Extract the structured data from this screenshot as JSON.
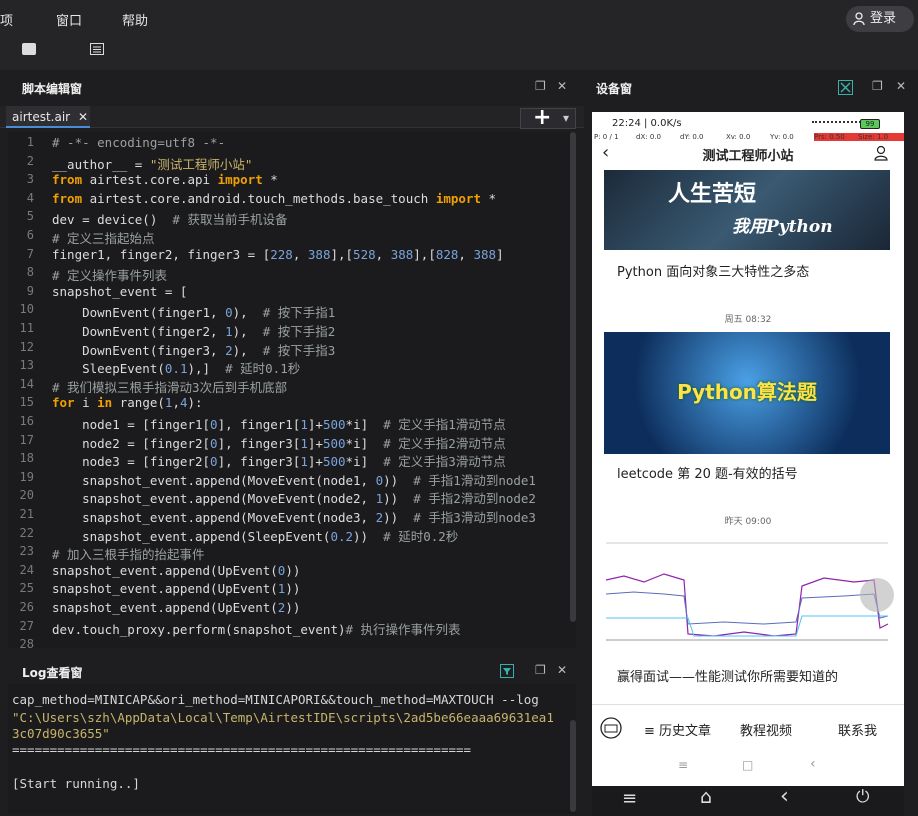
{
  "menu": {
    "items": [
      "项",
      "窗口",
      "帮助"
    ],
    "login": "登录"
  },
  "editor": {
    "title": "脚本编辑窗",
    "tab": "airtest.air",
    "tab_close": "✕",
    "plus": "+",
    "dropdown": "▾",
    "restore": "❐",
    "close": "✕"
  },
  "code_lines": [
    [
      [
        "cm",
        "# -*- encoding=utf8 -*-"
      ]
    ],
    [
      [
        "",
        "__author__ = "
      ],
      [
        "st",
        "\"测试工程师小站\""
      ]
    ],
    [
      [
        "kw",
        "from"
      ],
      [
        "",
        " airtest.core.api "
      ],
      [
        "kw",
        "import"
      ],
      [
        "",
        " *"
      ]
    ],
    [
      [
        "kw",
        "from"
      ],
      [
        "",
        " airtest.core.android.touch_methods.base_touch "
      ],
      [
        "kw",
        "import"
      ],
      [
        "",
        " *"
      ]
    ],
    [
      [
        "",
        "dev = device()  "
      ],
      [
        "cm",
        "# 获取当前手机设备"
      ]
    ],
    [
      [
        "cm",
        "# 定义三指起始点"
      ]
    ],
    [
      [
        "",
        "finger1, finger2, finger3 = ["
      ],
      [
        "nm",
        "228"
      ],
      [
        "",
        ", "
      ],
      [
        "nm",
        "388"
      ],
      [
        "",
        "],["
      ],
      [
        "nm",
        "528"
      ],
      [
        "",
        ", "
      ],
      [
        "nm",
        "388"
      ],
      [
        "",
        "],["
      ],
      [
        "nm",
        "828"
      ],
      [
        "",
        ", "
      ],
      [
        "nm",
        "388"
      ],
      [
        "",
        "]"
      ]
    ],
    [
      [
        "cm",
        "# 定义操作事件列表"
      ]
    ],
    [
      [
        "",
        "snapshot_event = ["
      ]
    ],
    [
      [
        "",
        "    DownEvent(finger1, "
      ],
      [
        "nm",
        "0"
      ],
      [
        "",
        "),  "
      ],
      [
        "cm",
        "# 按下手指1"
      ]
    ],
    [
      [
        "",
        "    DownEvent(finger2, "
      ],
      [
        "nm",
        "1"
      ],
      [
        "",
        "),  "
      ],
      [
        "cm",
        "# 按下手指2"
      ]
    ],
    [
      [
        "",
        "    DownEvent(finger3, "
      ],
      [
        "nm",
        "2"
      ],
      [
        "",
        "),  "
      ],
      [
        "cm",
        "# 按下手指3"
      ]
    ],
    [
      [
        "",
        "    SleepEvent("
      ],
      [
        "nm",
        "0.1"
      ],
      [
        "",
        "),]  "
      ],
      [
        "cm",
        "# 延时0.1秒"
      ]
    ],
    [
      [
        "cm",
        "# 我们模拟三根手指滑动3次后到手机底部"
      ]
    ],
    [
      [
        "kw",
        "for"
      ],
      [
        "",
        " i "
      ],
      [
        "kw",
        "in"
      ],
      [
        "",
        " range("
      ],
      [
        "nm",
        "1"
      ],
      [
        "",
        ","
      ],
      [
        "nm",
        "4"
      ],
      [
        "",
        "):"
      ]
    ],
    [
      [
        "",
        "    node1 = [finger1["
      ],
      [
        "nm",
        "0"
      ],
      [
        "",
        "], finger1["
      ],
      [
        "nm",
        "1"
      ],
      [
        "",
        "]+"
      ],
      [
        "nm",
        "500"
      ],
      [
        "",
        "*i]  "
      ],
      [
        "cm",
        "# 定义手指1滑动节点"
      ]
    ],
    [
      [
        "",
        "    node2 = [finger2["
      ],
      [
        "nm",
        "0"
      ],
      [
        "",
        "], finger3["
      ],
      [
        "nm",
        "1"
      ],
      [
        "",
        "]+"
      ],
      [
        "nm",
        "500"
      ],
      [
        "",
        "*i]  "
      ],
      [
        "cm",
        "# 定义手指2滑动节点"
      ]
    ],
    [
      [
        "",
        "    node3 = [finger2["
      ],
      [
        "nm",
        "0"
      ],
      [
        "",
        "], finger3["
      ],
      [
        "nm",
        "1"
      ],
      [
        "",
        "]+"
      ],
      [
        "nm",
        "500"
      ],
      [
        "",
        "*i]  "
      ],
      [
        "cm",
        "# 定义手指3滑动节点"
      ]
    ],
    [
      [
        "",
        "    snapshot_event.append(MoveEvent(node1, "
      ],
      [
        "nm",
        "0"
      ],
      [
        "",
        "))  "
      ],
      [
        "cm",
        "# 手指1滑动到node1"
      ]
    ],
    [
      [
        "",
        "    snapshot_event.append(MoveEvent(node2, "
      ],
      [
        "nm",
        "1"
      ],
      [
        "",
        "))  "
      ],
      [
        "cm",
        "# 手指2滑动到node2"
      ]
    ],
    [
      [
        "",
        "    snapshot_event.append(MoveEvent(node3, "
      ],
      [
        "nm",
        "2"
      ],
      [
        "",
        "))  "
      ],
      [
        "cm",
        "# 手指3滑动到node3"
      ]
    ],
    [
      [
        "",
        "    snapshot_event.append(SleepEvent("
      ],
      [
        "nm",
        "0.2"
      ],
      [
        "",
        "))  "
      ],
      [
        "cm",
        "# 延时0.2秒"
      ]
    ],
    [
      [
        "cm",
        "# 加入三根手指的抬起事件"
      ]
    ],
    [
      [
        "",
        "snapshot_event.append(UpEvent("
      ],
      [
        "nm",
        "0"
      ],
      [
        "",
        "))"
      ]
    ],
    [
      [
        "",
        "snapshot_event.append(UpEvent("
      ],
      [
        "nm",
        "1"
      ],
      [
        "",
        "))"
      ]
    ],
    [
      [
        "",
        "snapshot_event.append(UpEvent("
      ],
      [
        "nm",
        "2"
      ],
      [
        "",
        "))"
      ]
    ],
    [
      [
        "",
        "dev.touch_proxy.perform(snapshot_event)"
      ],
      [
        "cm",
        "# 执行操作事件列表"
      ]
    ],
    [
      [
        "",
        ""
      ]
    ]
  ],
  "log": {
    "title": "Log查看窗",
    "lines": [
      "cap_method=MINICAP&&ori_method=MINICAPORI&&touch_method=MAXTOUCH --log",
      "\"C:\\Users\\szh\\AppData\\Local\\Temp\\AirtestIDE\\scripts\\2ad5be66eaaa69631ea1",
      "3c07d90c3655\"",
      "=============================================================",
      "",
      "[Start running..]"
    ]
  },
  "device": {
    "title": "设备窗",
    "status": {
      "time": "22:24 | 0.0K/s",
      "battery": "99"
    },
    "pointer": {
      "p": "P: 0 / 1",
      "dx": "dX: 0.0",
      "dy": "dY: 0.0",
      "xv": "Xv: 0.0",
      "yv": "Yv: 0.0",
      "prs": "Prs: 0.50",
      "size": "Size: 1.0"
    },
    "header": "测试工程师小站",
    "banner1": {
      "line1": "人生苦短",
      "line2": "我用Python"
    },
    "article1": "Python 面向对象三大特性之多态",
    "date1": "周五 08:32",
    "banner2": "Python算法题",
    "article2": "leetcode 第 20 题-有效的括号",
    "date2": "昨天 09:00",
    "article3": "赢得面试——性能测试你所需要知道的",
    "bottom_menu": [
      "≡ 历史文章",
      "教程视频",
      "联系我"
    ],
    "nav": [
      "≡",
      "⌂",
      "‹",
      "⏻"
    ],
    "inner_nav": [
      "≡",
      "□",
      "‹"
    ]
  }
}
